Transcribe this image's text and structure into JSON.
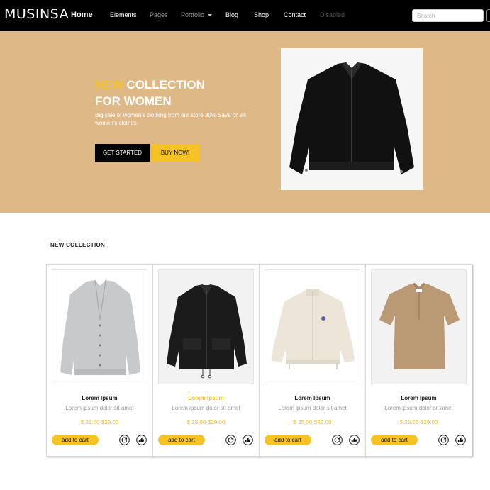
{
  "navbar": {
    "brand": "MUSINSA",
    "links": [
      {
        "label": "Home",
        "state": "active"
      },
      {
        "label": "Elements",
        "state": "normal"
      },
      {
        "label": "Pages",
        "state": "muted"
      },
      {
        "label": "Portfolio",
        "state": "muted"
      },
      {
        "label": "Blog",
        "state": "normal"
      },
      {
        "label": "Shop",
        "state": "normal"
      },
      {
        "label": "Contact",
        "state": "normal"
      },
      {
        "label": "Disabled",
        "state": "disabled"
      }
    ],
    "search_placeholder": "Search"
  },
  "hero": {
    "title_accent": "NEW",
    "title_rest": " COLLECTION",
    "title_line2": "FOR WOMEN",
    "description": "Big sale of women's clothing from our store 30% Save on all women's clothes",
    "cta_primary": "GET STARTED",
    "cta_secondary": "BUY NOW!",
    "background_color": "#deb887",
    "accent_color": "#f6c324"
  },
  "collection": {
    "title": "NEW COLLECTION",
    "products": [
      {
        "name": "Lorem Ipsum",
        "description": "Lorem ipsum dolor sit amet",
        "price": "$ 25.00-$29.00",
        "cart_label": "add to cart",
        "highlight": false,
        "image": "gray-cardigan"
      },
      {
        "name": "Lorem Ipsum",
        "description": "Lorem ipsum dolor sit amet",
        "price": "$ 25.00-$29.00",
        "cart_label": "add to cart",
        "highlight": true,
        "image": "black-jacket"
      },
      {
        "name": "Lorem Ipsum",
        "description": "Lorem ipsum dolor sit amet",
        "price": "$ 25.00-$29.00",
        "cart_label": "add to cart",
        "highlight": false,
        "image": "cream-fleece-jacket"
      },
      {
        "name": "Lorem Ipsum",
        "description": "Lorem ipsum dolor sit amet",
        "price": "$ 25.00-$29.00",
        "cart_label": "add to cart",
        "highlight": false,
        "image": "beige-shirt"
      }
    ]
  }
}
